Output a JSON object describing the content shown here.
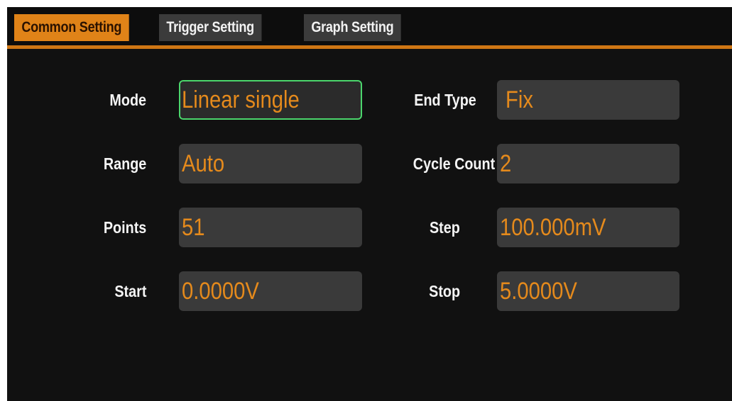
{
  "tabs": [
    {
      "label": "Common Setting",
      "active": true
    },
    {
      "label": "Trigger Setting",
      "active": false
    },
    {
      "label": "Graph Setting",
      "active": false
    }
  ],
  "colors": {
    "accent": "#e08318",
    "value_text": "#e58a1c",
    "focus_border": "#4bd66c",
    "background": "#111111",
    "field_bg": "#3a3a3a"
  },
  "fields": {
    "mode": {
      "label": "Mode",
      "value": "Linear single"
    },
    "range": {
      "label": "Range",
      "value": "Auto"
    },
    "points": {
      "label": "Points",
      "value": "51"
    },
    "start": {
      "label": "Start",
      "value": "0.0000V"
    },
    "end_type": {
      "label": "End Type",
      "value": "Fix"
    },
    "cycle_count": {
      "label": "Cycle Count",
      "value": "2"
    },
    "step": {
      "label": "Step",
      "value": "100.000mV"
    },
    "stop": {
      "label": "Stop",
      "value": "5.0000V"
    }
  }
}
